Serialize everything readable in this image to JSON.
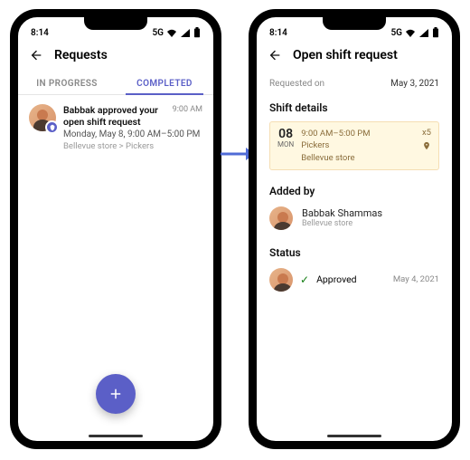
{
  "statusbar": {
    "time": "8:14",
    "network_label": "5G"
  },
  "left": {
    "header_title": "Requests",
    "tabs": {
      "in_progress": "IN PROGRESS",
      "completed": "COMPLETED"
    },
    "feed": {
      "title": "Babbak approved your open shift request",
      "time": "9:00 AM",
      "subtitle": "Monday, May 8, 9:00 AM–5:00 PM",
      "path": "Bellevue store > Pickers"
    }
  },
  "right": {
    "header_title": "Open shift request",
    "requested_label": "Requested on",
    "requested_date": "May 3, 2021",
    "shift_details_label": "Shift details",
    "shift": {
      "day_num": "08",
      "day_dow": "MON",
      "time": "9:00 AM–5:00 PM",
      "group": "Pickers",
      "store": "Bellevue store",
      "count": "x5"
    },
    "added_by_label": "Added by",
    "added_by_name": "Babbak Shammas",
    "added_by_store": "Bellevue store",
    "status_label": "Status",
    "status_value": "Approved",
    "status_date": "May 4, 2021"
  }
}
